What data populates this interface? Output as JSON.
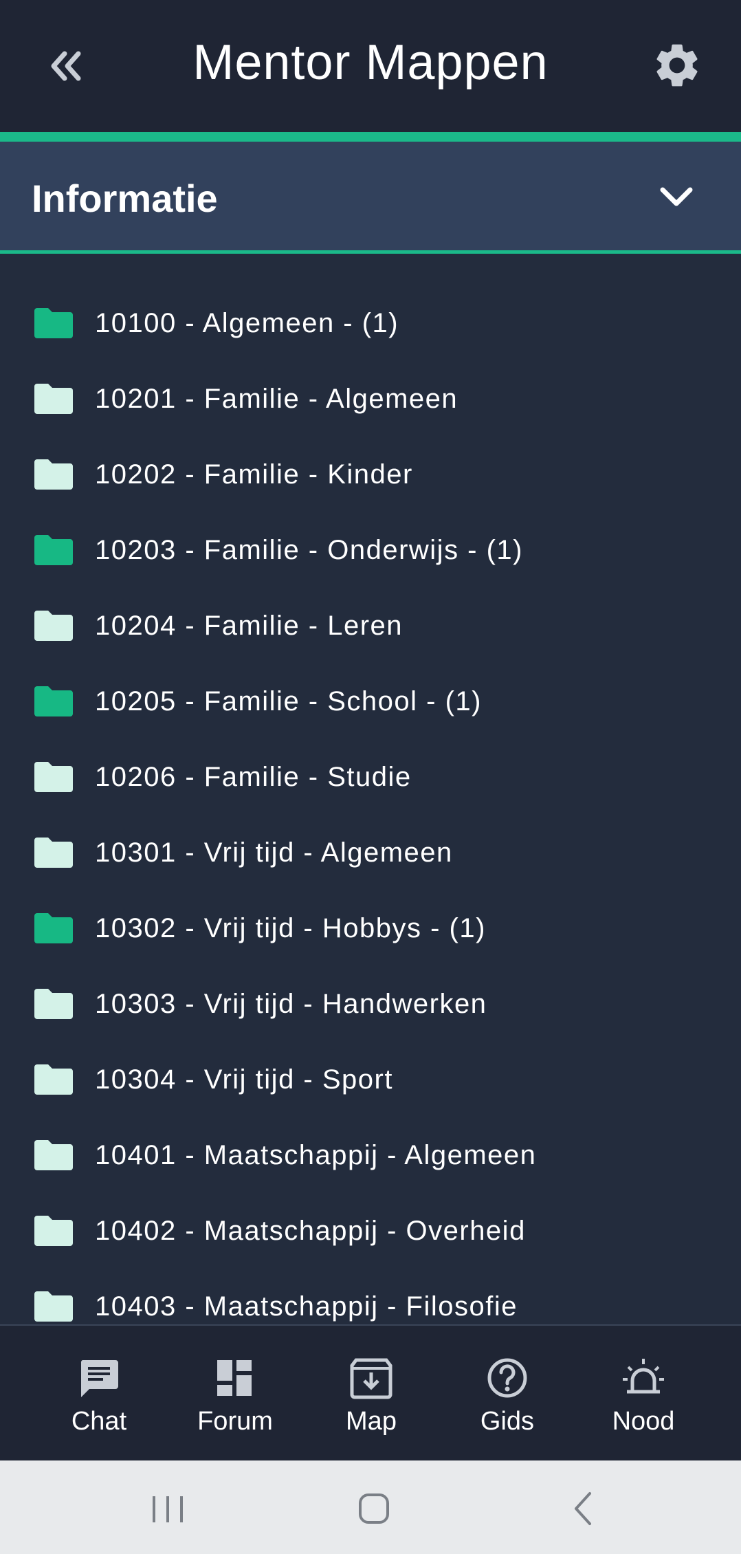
{
  "header": {
    "title": "Mentor Mappen",
    "back_icon": "double-chevron-left-icon",
    "settings_icon": "gear-icon"
  },
  "section": {
    "title": "Informatie",
    "chevron_icon": "chevron-down-icon"
  },
  "folders": [
    {
      "label": "10100 - Algemeen - (1)",
      "has_content": true
    },
    {
      "label": "10201 - Familie - Algemeen",
      "has_content": false
    },
    {
      "label": "10202 - Familie - Kinder",
      "has_content": false
    },
    {
      "label": "10203 - Familie - Onderwijs - (1)",
      "has_content": true
    },
    {
      "label": "10204 - Familie - Leren",
      "has_content": false
    },
    {
      "label": "10205 - Familie - School - (1)",
      "has_content": true
    },
    {
      "label": "10206 - Familie - Studie",
      "has_content": false
    },
    {
      "label": "10301 - Vrij tijd - Algemeen",
      "has_content": false
    },
    {
      "label": "10302 - Vrij tijd - Hobbys - (1)",
      "has_content": true
    },
    {
      "label": "10303 - Vrij tijd - Handwerken",
      "has_content": false
    },
    {
      "label": "10304 - Vrij tijd - Sport",
      "has_content": false
    },
    {
      "label": "10401 - Maatschappij - Algemeen",
      "has_content": false
    },
    {
      "label": "10402 - Maatschappij - Overheid",
      "has_content": false
    },
    {
      "label": "10403 - Maatschappij - Filosofie",
      "has_content": false
    }
  ],
  "colors": {
    "accent": "#1bb98a",
    "folder_filled": "#17b884",
    "folder_empty": "#d4f2e8",
    "background": "#232c3d",
    "header": "#1f2534",
    "section": "#32415c"
  },
  "nav": {
    "items": [
      {
        "label": "Chat",
        "icon": "chat-icon"
      },
      {
        "label": "Forum",
        "icon": "dashboard-icon"
      },
      {
        "label": "Map",
        "icon": "archive-download-icon"
      },
      {
        "label": "Gids",
        "icon": "help-circle-icon"
      },
      {
        "label": "Nood",
        "icon": "alarm-siren-icon"
      }
    ]
  },
  "system_bar": {
    "buttons": [
      "recent-apps-icon",
      "home-icon",
      "back-icon"
    ]
  }
}
